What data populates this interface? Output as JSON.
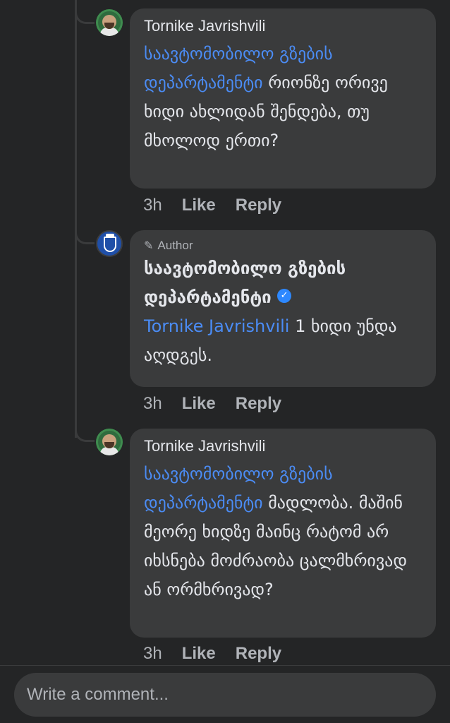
{
  "comments": [
    {
      "author": "Tornike Javrishvili",
      "mention": "საავტომობილო გზების დეპარტამენტი",
      "text": " რიონზე ორივე ხიდი ახლიდან შენდება, თუ მხოლოდ ერთი?",
      "time": "3h",
      "like_label": "Like",
      "reply_label": "Reply"
    },
    {
      "badge": "Author",
      "author": "საავტომობილო გზების დეპარტამენტი",
      "mention": "Tornike Javrishvili",
      "text": " 1 ხიდი უნდა აღდგეს.",
      "time": "3h",
      "like_label": "Like",
      "reply_label": "Reply"
    },
    {
      "author": "Tornike Javrishvili",
      "mention": "საავტომობილო გზების დეპარტამენტი",
      "text": " მადლობა. მაშინ მეორე ხიდზე მაინც რატომ არ იხსნება მოძრაობა ცალმხრივად ან ორმხრივად?",
      "time": "3h",
      "like_label": "Like",
      "reply_label": "Reply"
    }
  ],
  "composer": {
    "placeholder": "Write a comment..."
  },
  "colors": {
    "background": "#242526",
    "bubble": "#3a3b3c",
    "mention": "#4b8cf5",
    "verified": "#2d88ff"
  },
  "icons": [
    "pencil-icon",
    "verified-icon"
  ]
}
